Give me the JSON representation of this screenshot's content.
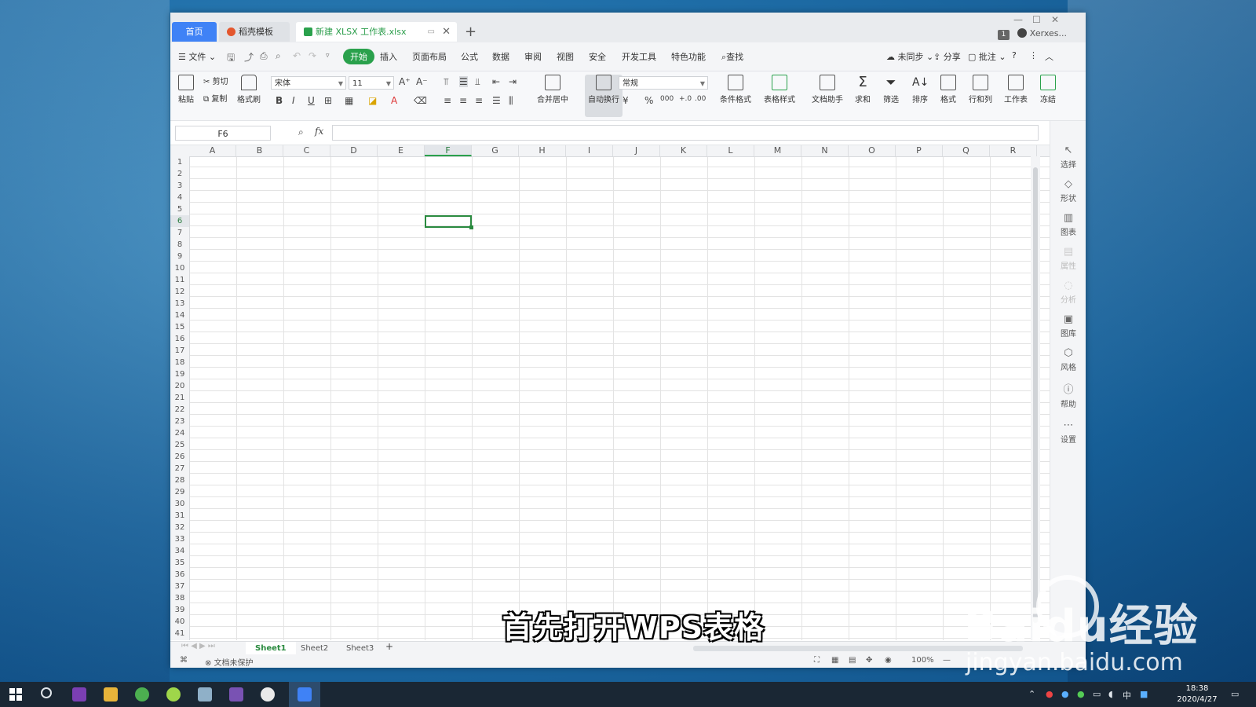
{
  "window": {
    "tabs": [
      {
        "label": "首页"
      },
      {
        "label": "稻壳模板"
      },
      {
        "label": "新建 XLSX 工作表.xlsx"
      }
    ],
    "account_name": "Xerxes...",
    "badge": "1"
  },
  "menu": {
    "file": "文件",
    "items": [
      "开始",
      "插入",
      "页面布局",
      "公式",
      "数据",
      "审阅",
      "视图",
      "安全",
      "开发工具",
      "特色功能"
    ],
    "active": "开始",
    "search": "查找",
    "sync": "未同步",
    "share": "分享",
    "comment": "批注"
  },
  "ribbon": {
    "paste": "粘贴",
    "cut": "剪切",
    "copy": "复制",
    "format_painter": "格式刷",
    "font_name": "宋体",
    "font_size": "11",
    "merge_center": "合并居中",
    "wrap_text": "自动换行",
    "number_format": "常规",
    "conditional_format": "条件格式",
    "table_style": "表格样式",
    "doc_helper": "文档助手",
    "sum": "求和",
    "filter": "筛选",
    "sort": "排序",
    "format": "格式",
    "row_col": "行和列",
    "worksheet": "工作表",
    "freeze": "冻结"
  },
  "formula_bar": {
    "name_box": "F6",
    "fx": "fx",
    "formula": ""
  },
  "grid": {
    "columns": [
      "A",
      "B",
      "C",
      "D",
      "E",
      "F",
      "G",
      "H",
      "I",
      "J",
      "K",
      "L",
      "M",
      "N",
      "O",
      "P",
      "Q",
      "R"
    ],
    "selected_column": "F",
    "rows": [
      "1",
      "2",
      "3",
      "4",
      "5",
      "6",
      "7",
      "8",
      "9",
      "10",
      "11",
      "12",
      "13",
      "14",
      "15",
      "16",
      "17",
      "18",
      "19",
      "20",
      "21",
      "22",
      "23",
      "24",
      "25",
      "26",
      "27",
      "28",
      "29",
      "30",
      "31",
      "32",
      "33",
      "34",
      "35",
      "36",
      "37",
      "38",
      "39",
      "40",
      "41"
    ],
    "selected_row": "6"
  },
  "side_panel": [
    "选择",
    "形状",
    "图表",
    "属性",
    "分析",
    "图库",
    "风格",
    "帮助",
    "设置"
  ],
  "sheets": [
    "Sheet1",
    "Sheet2",
    "Sheet3"
  ],
  "active_sheet": "Sheet1",
  "status": {
    "protection": "文档未保护",
    "zoom": "100%"
  },
  "subtitle": "首先打开WPS表格",
  "watermark": {
    "brand": "Baidu经验",
    "url": "jingyan.baidu.com"
  },
  "taskbar": {
    "time": "18:38",
    "date": "2020/4/27",
    "ime": "中"
  },
  "colors": {
    "wps_green": "#2aa14c",
    "home_tab_blue": "#3f82f6",
    "taskbar_bg": "#1a2734"
  }
}
